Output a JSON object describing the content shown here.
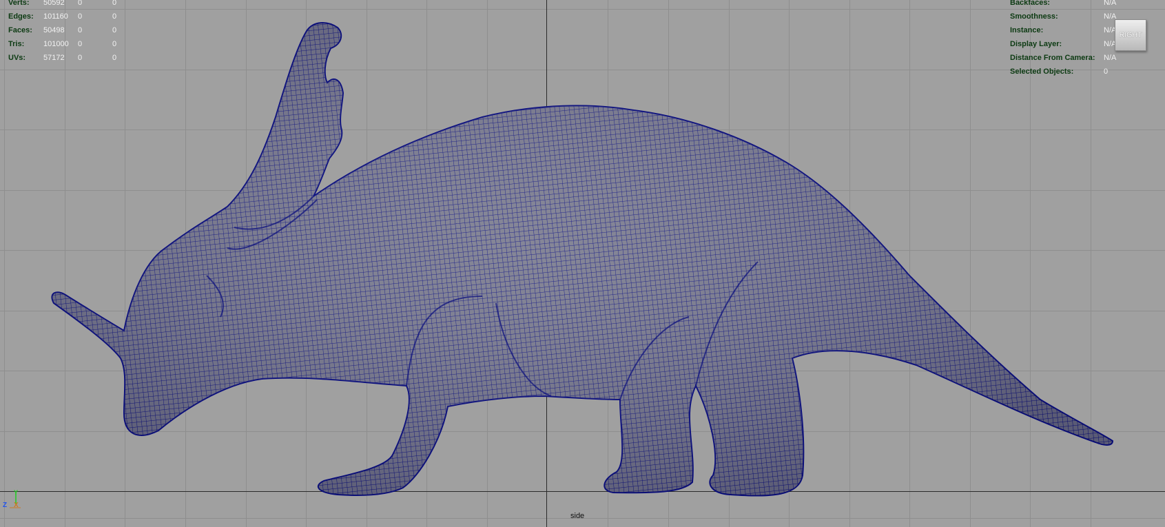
{
  "viewport": {
    "camera": "side",
    "view_cube_label": "RIGHT",
    "background_color": "#a0a0a0",
    "grid_color": "#8f8f8f",
    "wire_color": "#0a0e7e"
  },
  "stats": {
    "rows": [
      {
        "label": "Verts:",
        "value": "50592",
        "sel1": "0",
        "sel2": "0"
      },
      {
        "label": "Edges:",
        "value": "101160",
        "sel1": "0",
        "sel2": "0"
      },
      {
        "label": "Faces:",
        "value": "50498",
        "sel1": "0",
        "sel2": "0"
      },
      {
        "label": "Tris:",
        "value": "101000",
        "sel1": "0",
        "sel2": "0"
      },
      {
        "label": "UVs:",
        "value": "57172",
        "sel1": "0",
        "sel2": "0"
      }
    ]
  },
  "object_details": {
    "rows": [
      {
        "label": "Backfaces:",
        "value": "N/A"
      },
      {
        "label": "Smoothness:",
        "value": "N/A"
      },
      {
        "label": "Instance:",
        "value": "N/A"
      },
      {
        "label": "Display Layer:",
        "value": "N/A"
      },
      {
        "label": "Distance From Camera:",
        "value": "N/A"
      },
      {
        "label": "Selected Objects:",
        "value": "0"
      }
    ]
  },
  "axis": {
    "z": "Z",
    "x": "X",
    "y": "Y",
    "y_color": "#22cc22",
    "z_color": "#2255ee",
    "x_color": "#cc7a22"
  }
}
